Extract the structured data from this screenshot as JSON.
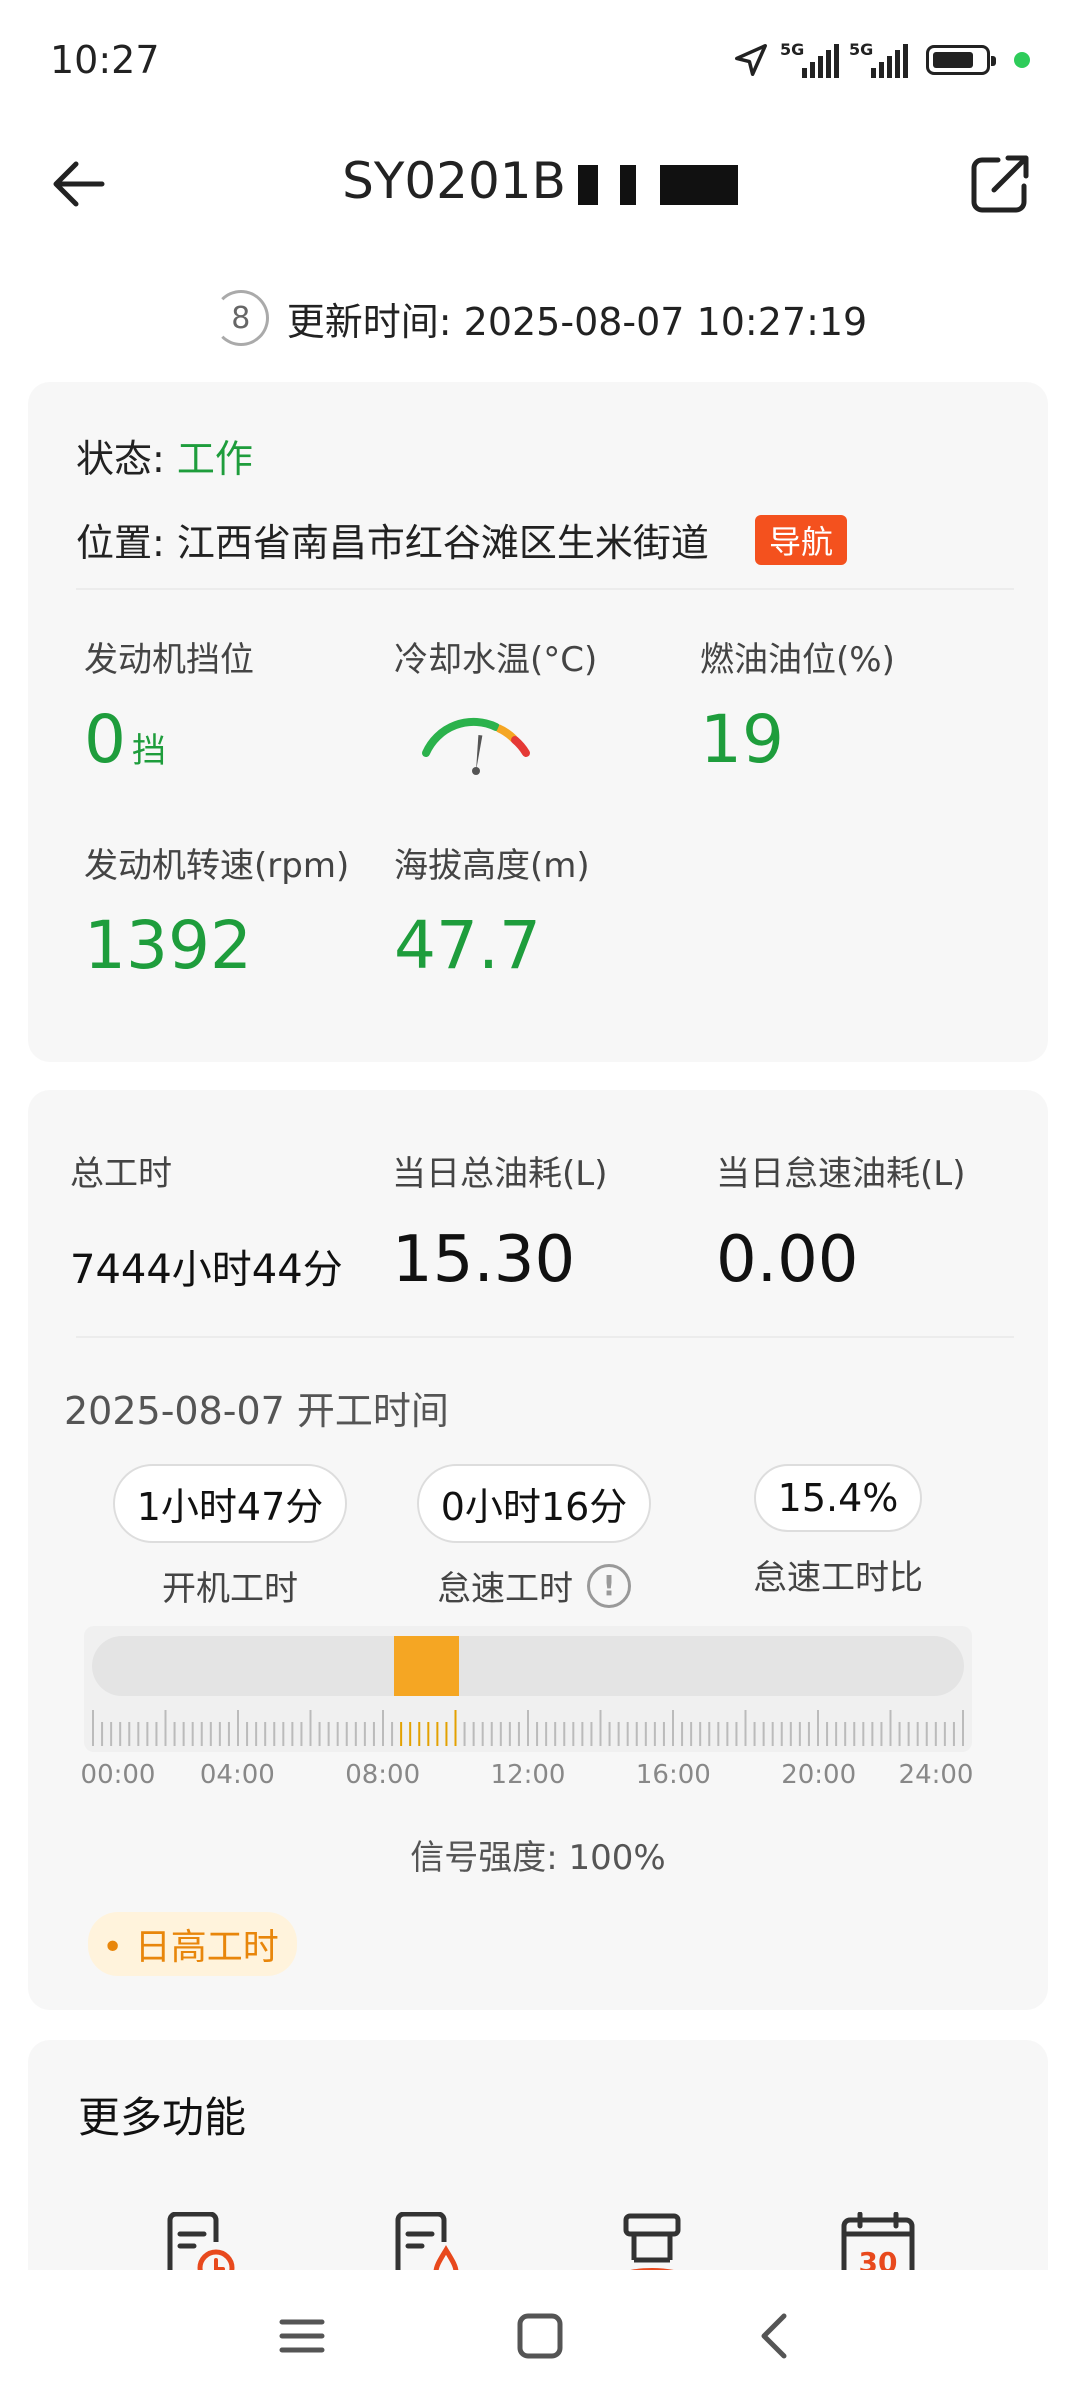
{
  "status_bar": {
    "time": "10:27",
    "net1": "5G",
    "net2": "5G"
  },
  "header": {
    "title": "SY0201B",
    "back_icon": "arrow-left-icon",
    "share_icon": "external-link-icon"
  },
  "update": {
    "countdown": "8",
    "text": "更新时间: 2025-08-07 10:27:19"
  },
  "device": {
    "status_label": "状态:",
    "status_value": "工作",
    "location_label": "位置:",
    "location_value": "江西省南昌市红谷滩区生米街道",
    "nav_button": "导航"
  },
  "metrics": [
    {
      "label": "发动机挡位",
      "value": "0",
      "unit": "挡"
    },
    {
      "label": "冷却水温(°C)",
      "gauge_level": 0.55
    },
    {
      "label": "燃油油位(%)",
      "value": "19"
    },
    {
      "label": "发动机转速(rpm)",
      "value": "1392"
    },
    {
      "label": "海拔高度(m)",
      "value": "47.7"
    }
  ],
  "stats": [
    {
      "label": "总工时",
      "value": "7444小时44分"
    },
    {
      "label": "当日总油耗(L)",
      "value": "15.30"
    },
    {
      "label": "当日怠速油耗(L)",
      "value": "0.00"
    }
  ],
  "worktime": {
    "date_label": "2025-08-07  开工时间",
    "pills": [
      {
        "value": "1小时47分",
        "label": "开机工时"
      },
      {
        "value": "0小时16分",
        "label": "怠速工时"
      },
      {
        "value": "15.4%",
        "label": "怠速工时比"
      }
    ],
    "timeline": {
      "start_hour": 8.3,
      "end_hour": 10.1,
      "ticks": [
        "00:00",
        "04:00",
        "08:00",
        "12:00",
        "16:00",
        "20:00",
        "24:00"
      ]
    },
    "signal": "信号强度: 100%",
    "daily_tag": "日高工时"
  },
  "more": {
    "title": "更多功能",
    "icons": [
      "document-clock-icon",
      "document-fuel-icon",
      "machine-icon",
      "calendar-icon"
    ],
    "calendar_day": "30"
  },
  "colors": {
    "accent_green": "#1e9d3c",
    "nav_orange": "#f4511e",
    "timeline_orange": "#f5a623"
  }
}
